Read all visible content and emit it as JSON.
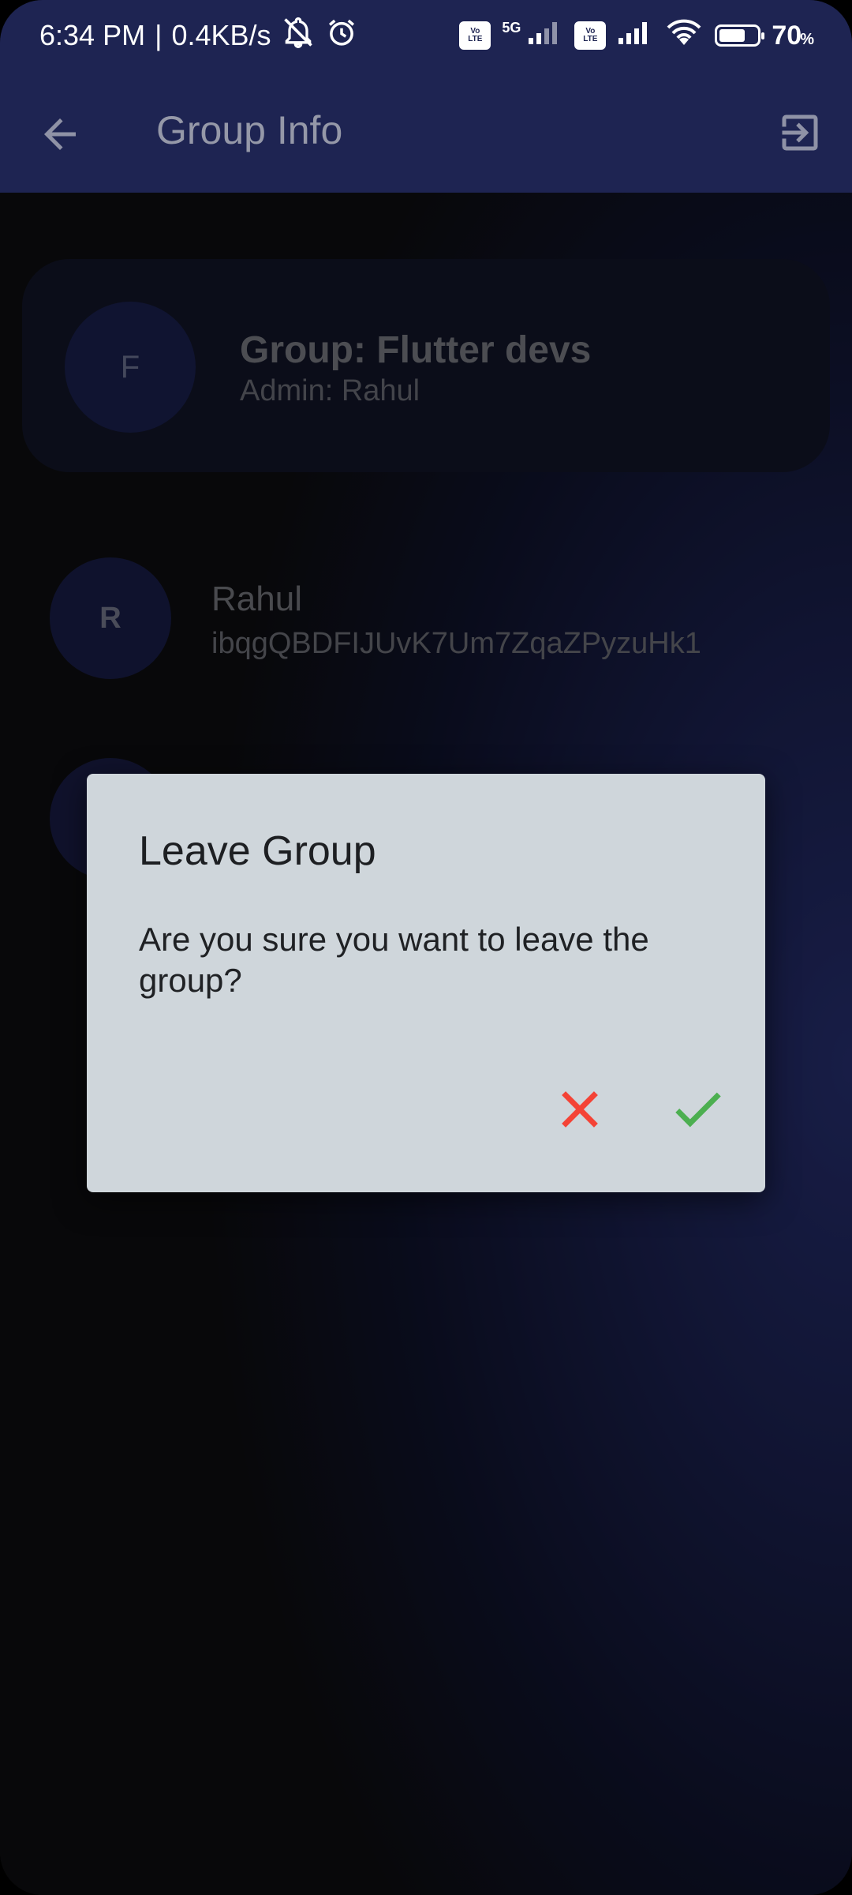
{
  "status_bar": {
    "time": "6:34 PM",
    "separator": "|",
    "speed": "0.4KB/s",
    "network_label": "5G",
    "volte_top": "Vo",
    "volte_bottom": "LTE",
    "battery_percent": "70",
    "battery_sign": "%",
    "battery_level": 0.7
  },
  "app_bar": {
    "title": "Group Info"
  },
  "group": {
    "avatar_letter": "F",
    "name": "Group: Flutter devs",
    "admin": "Admin: Rahul"
  },
  "members": [
    {
      "avatar_letter": "R",
      "name": "Rahul",
      "id": "ibqgQBDFIJUvK7Um7ZqaZPyzuHk1"
    }
  ],
  "dialog": {
    "title": "Leave Group",
    "message": "Are you sure you want to leave the group?"
  },
  "colors": {
    "app_bar": "#1e2452",
    "dialog_bg": "#cfd6db",
    "cancel": "#f44336",
    "confirm": "#4caf50"
  }
}
